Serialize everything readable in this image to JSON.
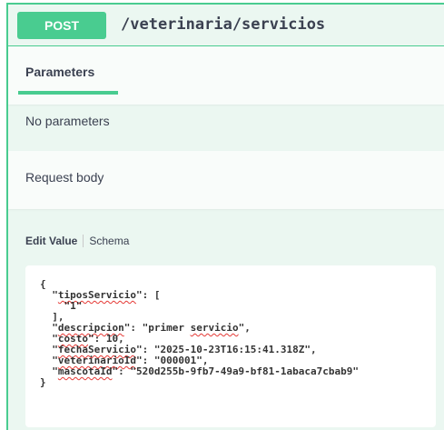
{
  "operation": {
    "method": "POST",
    "path": "/veterinaria/servicios",
    "method_color": "#49cc90"
  },
  "tabs": {
    "parameters": "Parameters"
  },
  "parameters": {
    "empty_text": "No parameters"
  },
  "request_body": {
    "label": "Request body",
    "edit_value_tab": "Edit Value",
    "schema_tab": "Schema",
    "json": {
      "l1": "{",
      "k_tipos": "tiposServicio",
      "l2_rest": ": [",
      "l3": "    \"1\"",
      "l4": "  ],",
      "k_desc": "descripcion",
      "v_desc_pre": ": \"primer ",
      "v_desc_word": "servicio",
      "v_desc_post": "\",",
      "k_costo": "costo",
      "v_costo": ": 10,",
      "k_fecha": "fechaServicio",
      "v_fecha": ": \"2025-10-23T16:15:41.318Z\",",
      "k_vet": "veterinarioId",
      "v_vet": ": \"000001\",",
      "k_masc": "mascotaId",
      "v_masc": ": \"520d255b-9fb7-49a9-bf81-1abaca7cbab9\"",
      "l_end": "}"
    }
  }
}
